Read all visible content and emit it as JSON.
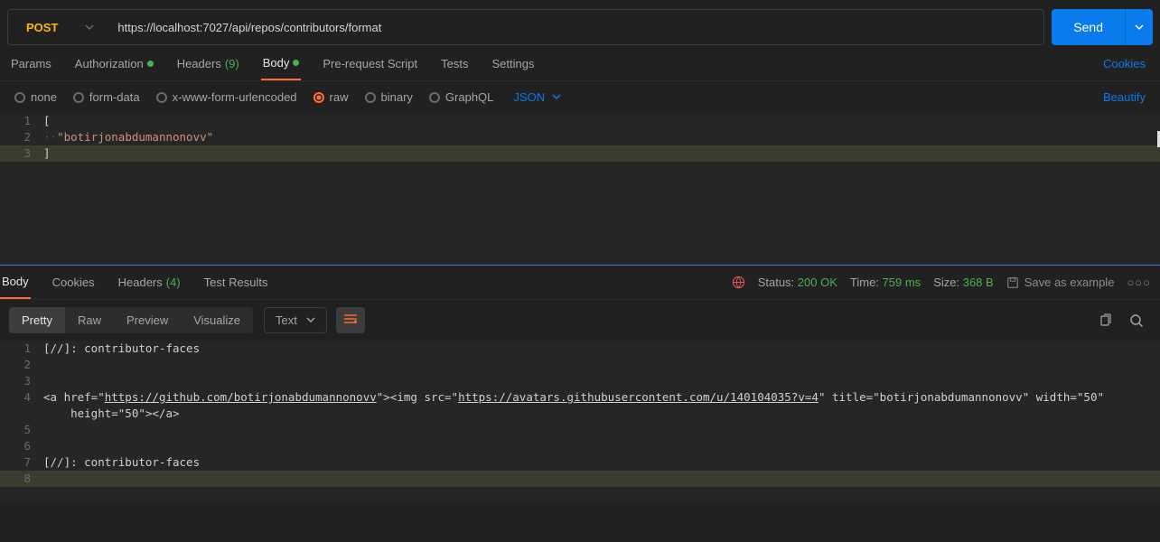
{
  "request": {
    "method": "POST",
    "url": "https://localhost:7027/api/repos/contributors/format",
    "send_label": "Send"
  },
  "tabs": {
    "params": "Params",
    "authorization": "Authorization",
    "headers": "Headers",
    "headers_count": "(9)",
    "body": "Body",
    "prescript": "Pre-request Script",
    "tests": "Tests",
    "settings": "Settings",
    "cookies_link": "Cookies"
  },
  "body_types": {
    "none": "none",
    "formdata": "form-data",
    "xwww": "x-www-form-urlencoded",
    "raw": "raw",
    "binary": "binary",
    "graphql": "GraphQL",
    "json": "JSON",
    "beautify": "Beautify"
  },
  "req_editor": {
    "l1": "[",
    "l2_indent": "··",
    "l2_str": "\"botirjonabdumannonovv\"",
    "l3": "]"
  },
  "response": {
    "body": "Body",
    "cookies": "Cookies",
    "headers": "Headers",
    "headers_count": "(4)",
    "testresults": "Test Results",
    "status_label": "Status:",
    "status_value": "200 OK",
    "time_label": "Time:",
    "time_value": "759 ms",
    "size_label": "Size:",
    "size_value": "368 B",
    "save_example": "Save as example"
  },
  "resp_toolbar": {
    "pretty": "Pretty",
    "raw": "Raw",
    "preview": "Preview",
    "visualize": "Visualize",
    "text": "Text"
  },
  "resp_editor": {
    "l1": "[//]: contributor-faces",
    "l4_a": "<a href=\"",
    "l4_url1": "https://github.com/botirjonabdumannonovv",
    "l4_b": "\"><img src=\"",
    "l4_url2": "https://avatars.githubusercontent.com/u/140104035?v=4",
    "l4_c": "\" title=\"botirjonabdumannonovv\" width=\"50\" ",
    "l4_wrap": "    height=\"50\"></a>",
    "l7": "[//]: contributor-faces"
  }
}
